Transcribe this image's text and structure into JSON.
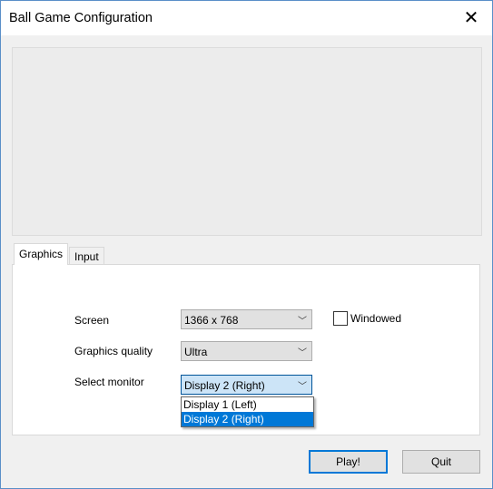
{
  "window": {
    "title": "Ball Game Configuration",
    "close_icon": "close-icon"
  },
  "tabs": [
    {
      "label": "Graphics",
      "active": true
    },
    {
      "label": "Input",
      "active": false
    }
  ],
  "graphics": {
    "screen": {
      "label": "Screen",
      "value": "1366 x 768"
    },
    "windowed": {
      "label": "Windowed",
      "checked": false
    },
    "quality": {
      "label": "Graphics quality",
      "value": "Ultra"
    },
    "monitor": {
      "label": "Select monitor",
      "value": "Display 2 (Right)",
      "options": [
        "Display 1 (Left)",
        "Display 2 (Right)"
      ]
    }
  },
  "buttons": {
    "play": "Play!",
    "quit": "Quit"
  },
  "colors": {
    "accent": "#0078d7"
  }
}
